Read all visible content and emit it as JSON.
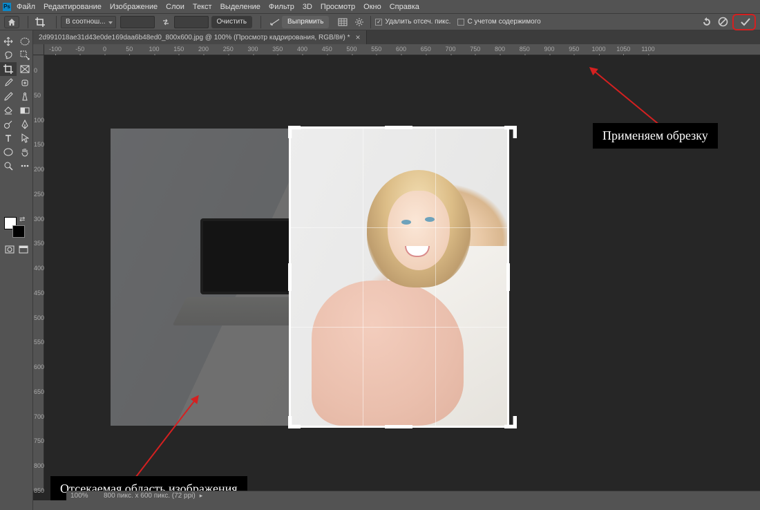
{
  "menubar": {
    "items": [
      "Файл",
      "Редактирование",
      "Изображение",
      "Слои",
      "Текст",
      "Выделение",
      "Фильтр",
      "3D",
      "Просмотр",
      "Окно",
      "Справка"
    ]
  },
  "optionsbar": {
    "aspect_label": "В соотнош...",
    "width_value": "",
    "height_value": "",
    "clear_btn": "Очистить",
    "straighten_btn": "Выпрямить",
    "delete_pixels_label": "Удалить отсеч. пикс.",
    "content_aware_label": "С учетом содержимого"
  },
  "document": {
    "tab_title": "2d991018ae31d43e0de169daa6b48ed0_800x600.jpg @ 100% (Просмотр кадрирования, RGB/8#) *"
  },
  "ruler_h": [
    "-100",
    "-50",
    "0",
    "50",
    "100",
    "150",
    "200",
    "250",
    "300",
    "350",
    "400",
    "450",
    "500",
    "550",
    "600",
    "650",
    "700",
    "750",
    "800",
    "850",
    "900",
    "950",
    "1000",
    "1050",
    "1100"
  ],
  "ruler_v": [
    "0",
    "50",
    "100",
    "150",
    "200",
    "250",
    "300",
    "350",
    "400",
    "450",
    "500",
    "550",
    "600",
    "650",
    "700",
    "750",
    "800",
    "850"
  ],
  "callouts": {
    "apply_crop": "Применяем обрезку",
    "cut_area": "Отсекаемая область изображения"
  },
  "statusbar": {
    "zoom": "100%",
    "doc_info": "800 пикс. x 600 пикс. (72 ppi)"
  },
  "colors": {
    "accent_red": "#d52020"
  }
}
